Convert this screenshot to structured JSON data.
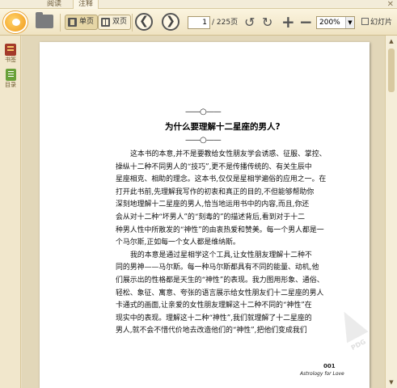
{
  "tabs": [
    {
      "label": "阅读"
    },
    {
      "label": "注释"
    }
  ],
  "close_glyph": "✕",
  "toolbar": {
    "single_page": "单页",
    "double_page": "双页",
    "prev_glyph": "❮",
    "next_glyph": "❯",
    "page_current": "1",
    "page_total": "/ 225页",
    "rotate_left_glyph": "↺",
    "rotate_right_glyph": "↻",
    "zoom_in_glyph": "+",
    "zoom_out_glyph": "−",
    "zoom_value": "200%",
    "zoom_arrow": "▼",
    "slideshow": "幻灯片"
  },
  "sidebar": {
    "items": [
      {
        "label": "书签",
        "icon": "bookmark-icon"
      },
      {
        "label": "目录",
        "icon": "toc-icon"
      }
    ]
  },
  "scroll": {
    "up": "▲",
    "down": "▼"
  },
  "page": {
    "ornament": "——○——",
    "title": "为什么要理解十二星座的男人?",
    "lines": [
      {
        "text": "这本书的本意,并不是要教给女性朋友学会诱惑、征服、掌控、",
        "indent": true
      },
      {
        "text": "操纵十二种不同男人的“技巧”,更不是传播传统的、有关生辰中",
        "indent": false
      },
      {
        "text": "星座相克、相助的理念。这本书,仅仅是星相学遍俗的应用之一。在",
        "indent": false
      },
      {
        "text": "打开此书前,先理解我写作的初衷和真正的目的,不但能够帮助你",
        "indent": false
      },
      {
        "text": "深刻地理解十二星座的男人,恰当地运用书中的内容,而且,你还",
        "indent": false
      },
      {
        "text": "会从对十二种“坏男人”的“刻毒的”的描述背后,看到对于十二",
        "indent": false
      },
      {
        "text": "种男人性中所散发的“神性”的由衷热爱和赞美。每一个男人都是一",
        "indent": false
      },
      {
        "text": "个马尔斯,正如每一个女人都是维纳斯。",
        "indent": false
      },
      {
        "text": "我的本意是通过星相学这个工具,让女性朋友理解十二种不",
        "indent": true
      },
      {
        "text": "同的男神——马尔斯。每一种马尔斯都具有不同的能量、动机,他",
        "indent": false
      },
      {
        "text": "们展示出的性格都是天生的“神性”的表现。我力图用形象、通俗、",
        "indent": false
      },
      {
        "text": "轻松、象征、寓意、夸张的语言展示给女性朋友们十二星座的男人",
        "indent": false
      },
      {
        "text": "卡通式的画面,让亲爱的女性朋友理解这十二种不同的“神性”在",
        "indent": false
      },
      {
        "text": "现实中的表现。理解这十二种“神性”,我们就理解了十二星座的",
        "indent": false
      },
      {
        "text": "男人,就不会不惜代价地去改造他们的“神性”,把他们变成我们",
        "indent": false
      }
    ],
    "page_number": "001",
    "footer": "Astrology for Love",
    "watermark": "PDG"
  }
}
